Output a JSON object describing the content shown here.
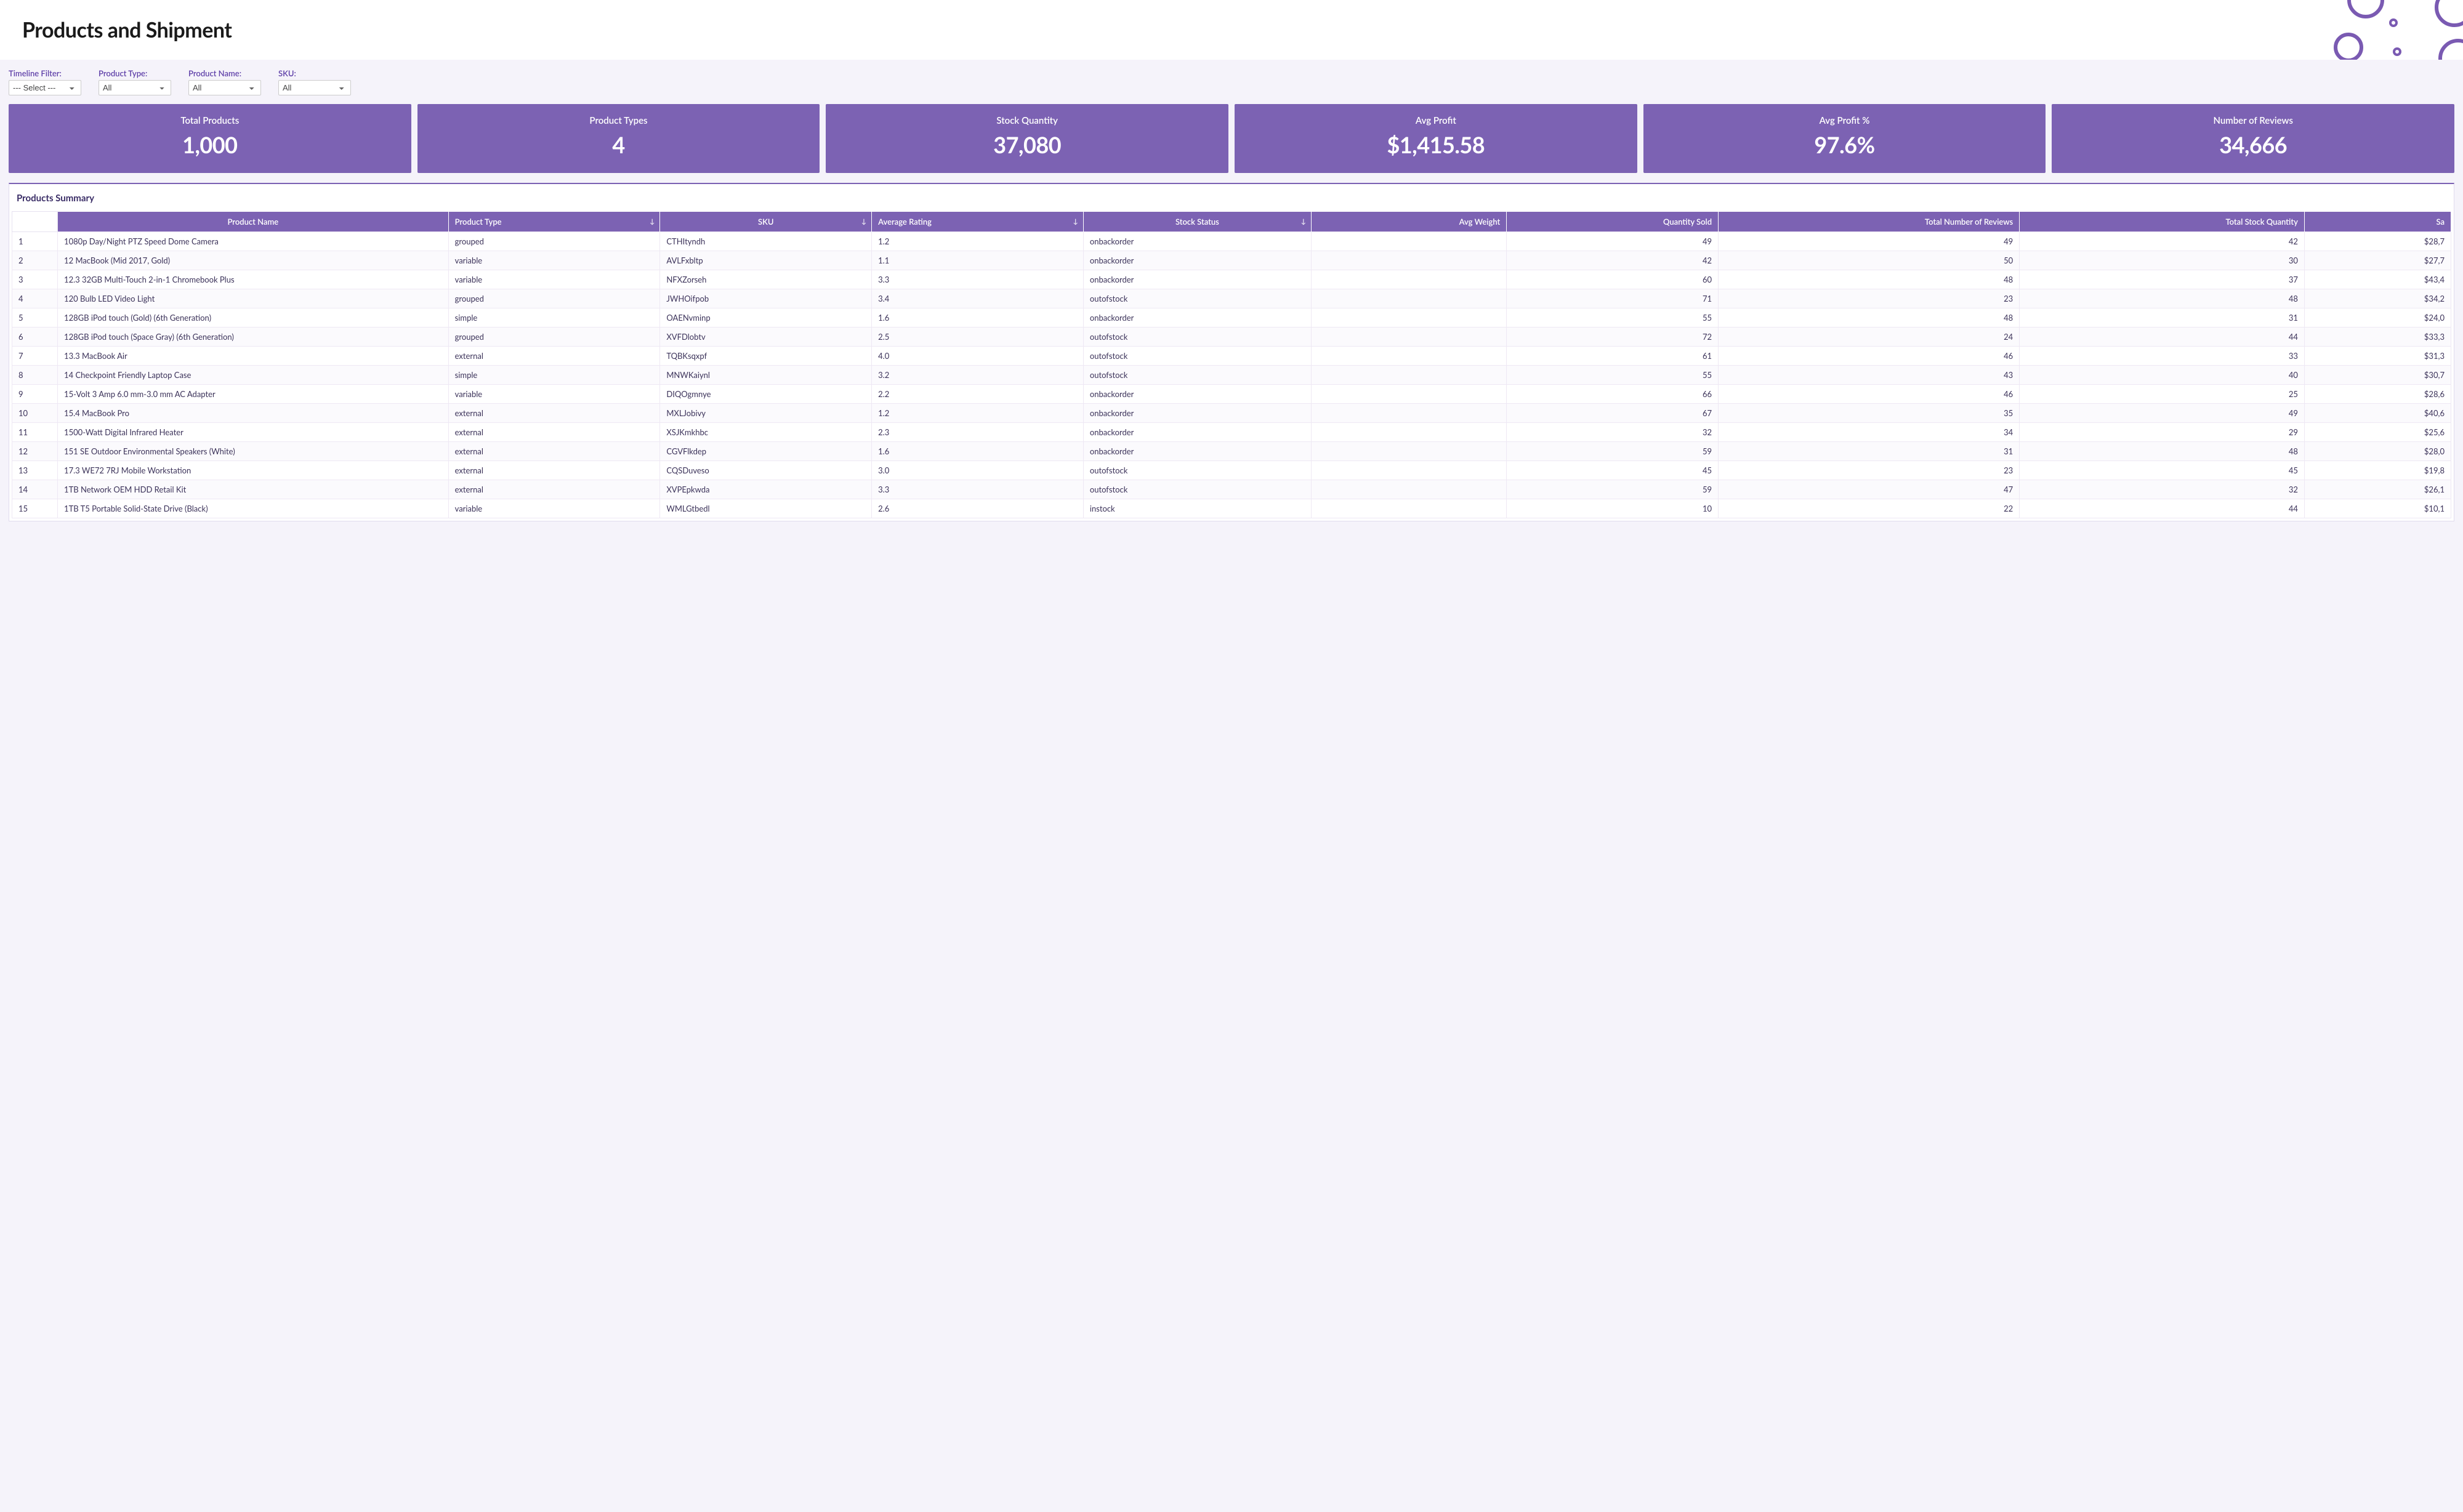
{
  "header": {
    "title": "Products and Shipment"
  },
  "filters": [
    {
      "label": "Timeline Filter:",
      "value": "--- Select ---"
    },
    {
      "label": "Product Type:",
      "value": "All"
    },
    {
      "label": "Product Name:",
      "value": "All"
    },
    {
      "label": "SKU:",
      "value": "All"
    }
  ],
  "kpis": [
    {
      "label": "Total Products",
      "value": "1,000"
    },
    {
      "label": "Product Types",
      "value": "4"
    },
    {
      "label": "Stock Quantity",
      "value": "37,080"
    },
    {
      "label": "Avg Profit",
      "value": "$1,415.58"
    },
    {
      "label": "Avg Profit %",
      "value": "97.6%"
    },
    {
      "label": "Number of Reviews",
      "value": "34,666"
    }
  ],
  "table": {
    "title": "Products Summary",
    "columns": [
      "Product Name",
      "Product Type",
      "SKU",
      "Average Rating",
      "Stock Status",
      "Avg Weight",
      "Quantity Sold",
      "Total Number of Reviews",
      "Total Stock Quantity",
      "Sa"
    ],
    "rows": [
      {
        "n": "1",
        "name": "1080p Day/Night PTZ Speed Dome Camera",
        "type": "grouped",
        "sku": "CTHItyndh",
        "rating": "1.2",
        "stock_status": "onbackorder",
        "avg_weight": "",
        "qty_sold": "49",
        "reviews": "49",
        "stock_qty": "42",
        "sales": "$28,7"
      },
      {
        "n": "2",
        "name": "12 MacBook (Mid 2017, Gold)",
        "type": "variable",
        "sku": "AVLFxbltp",
        "rating": "1.1",
        "stock_status": "onbackorder",
        "avg_weight": "",
        "qty_sold": "42",
        "reviews": "50",
        "stock_qty": "30",
        "sales": "$27,7"
      },
      {
        "n": "3",
        "name": "12.3 32GB Multi-Touch 2-in-1 Chromebook Plus",
        "type": "variable",
        "sku": "NFXZorseh",
        "rating": "3.3",
        "stock_status": "onbackorder",
        "avg_weight": "",
        "qty_sold": "60",
        "reviews": "48",
        "stock_qty": "37",
        "sales": "$43,4"
      },
      {
        "n": "4",
        "name": "120 Bulb LED Video Light",
        "type": "grouped",
        "sku": "JWHOifpob",
        "rating": "3.4",
        "stock_status": "outofstock",
        "avg_weight": "",
        "qty_sold": "71",
        "reviews": "23",
        "stock_qty": "48",
        "sales": "$34,2"
      },
      {
        "n": "5",
        "name": "128GB iPod touch (Gold) (6th Generation)",
        "type": "simple",
        "sku": "OAENvminp",
        "rating": "1.6",
        "stock_status": "onbackorder",
        "avg_weight": "",
        "qty_sold": "55",
        "reviews": "48",
        "stock_qty": "31",
        "sales": "$24,0"
      },
      {
        "n": "6",
        "name": "128GB iPod touch (Space Gray) (6th Generation)",
        "type": "grouped",
        "sku": "XVFDlobtv",
        "rating": "2.5",
        "stock_status": "outofstock",
        "avg_weight": "",
        "qty_sold": "72",
        "reviews": "24",
        "stock_qty": "44",
        "sales": "$33,3"
      },
      {
        "n": "7",
        "name": "13.3 MacBook Air",
        "type": "external",
        "sku": "TQBKsqxpf",
        "rating": "4.0",
        "stock_status": "outofstock",
        "avg_weight": "",
        "qty_sold": "61",
        "reviews": "46",
        "stock_qty": "33",
        "sales": "$31,3"
      },
      {
        "n": "8",
        "name": "14 Checkpoint Friendly Laptop Case",
        "type": "simple",
        "sku": "MNWKaiynl",
        "rating": "3.2",
        "stock_status": "outofstock",
        "avg_weight": "",
        "qty_sold": "55",
        "reviews": "43",
        "stock_qty": "40",
        "sales": "$30,7"
      },
      {
        "n": "9",
        "name": "15-Volt 3 Amp 6.0 mm-3.0 mm AC Adapter",
        "type": "variable",
        "sku": "DIQOgmnye",
        "rating": "2.2",
        "stock_status": "onbackorder",
        "avg_weight": "",
        "qty_sold": "66",
        "reviews": "46",
        "stock_qty": "25",
        "sales": "$28,6"
      },
      {
        "n": "10",
        "name": "15.4 MacBook Pro",
        "type": "external",
        "sku": "MXLJobivy",
        "rating": "1.2",
        "stock_status": "onbackorder",
        "avg_weight": "",
        "qty_sold": "67",
        "reviews": "35",
        "stock_qty": "49",
        "sales": "$40,6"
      },
      {
        "n": "11",
        "name": "1500-Watt Digital Infrared Heater",
        "type": "external",
        "sku": "XSJKmkhbc",
        "rating": "2.3",
        "stock_status": "onbackorder",
        "avg_weight": "",
        "qty_sold": "32",
        "reviews": "34",
        "stock_qty": "29",
        "sales": "$25,6"
      },
      {
        "n": "12",
        "name": "151 SE Outdoor Environmental Speakers (White)",
        "type": "external",
        "sku": "CGVFlkdep",
        "rating": "1.6",
        "stock_status": "onbackorder",
        "avg_weight": "",
        "qty_sold": "59",
        "reviews": "31",
        "stock_qty": "48",
        "sales": "$28,0"
      },
      {
        "n": "13",
        "name": "17.3 WE72 7RJ Mobile Workstation",
        "type": "external",
        "sku": "CQSDuveso",
        "rating": "3.0",
        "stock_status": "outofstock",
        "avg_weight": "",
        "qty_sold": "45",
        "reviews": "23",
        "stock_qty": "45",
        "sales": "$19,8"
      },
      {
        "n": "14",
        "name": "1TB Network OEM HDD Retail Kit",
        "type": "external",
        "sku": "XVPEpkwda",
        "rating": "3.3",
        "stock_status": "outofstock",
        "avg_weight": "",
        "qty_sold": "59",
        "reviews": "47",
        "stock_qty": "32",
        "sales": "$26,1"
      },
      {
        "n": "15",
        "name": "1TB T5 Portable Solid-State Drive (Black)",
        "type": "variable",
        "sku": "WMLGtbedl",
        "rating": "2.6",
        "stock_status": "instock",
        "avg_weight": "",
        "qty_sold": "10",
        "reviews": "22",
        "stock_qty": "44",
        "sales": "$10,1"
      }
    ]
  }
}
